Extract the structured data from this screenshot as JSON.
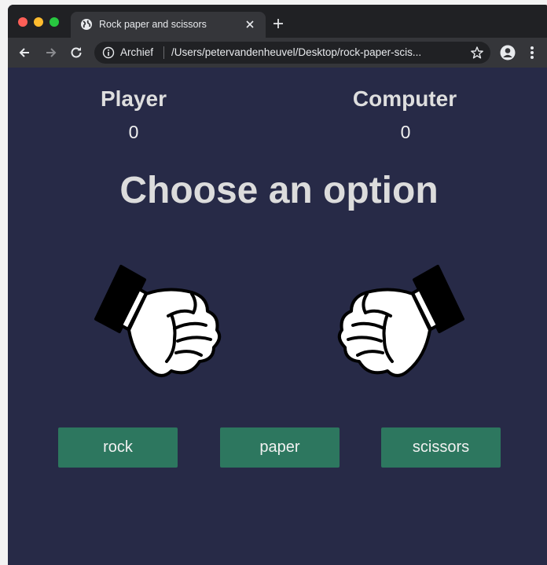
{
  "browser": {
    "tab": {
      "title": "Rock paper and scissors",
      "icon": "globe-icon"
    },
    "address_bar": {
      "site_label": "Archief",
      "url": "/Users/petervandenheuvel/Desktop/rock-paper-scis..."
    }
  },
  "game": {
    "player": {
      "label": "Player",
      "score": "0"
    },
    "computer": {
      "label": "Computer",
      "score": "0"
    },
    "headline": "Choose an option",
    "choices": [
      {
        "label": "rock"
      },
      {
        "label": "paper"
      },
      {
        "label": "scissors"
      }
    ],
    "player_hand": "rock-fist-icon",
    "computer_hand": "rock-fist-icon"
  },
  "colors": {
    "page_background": "#272a47",
    "button_background": "#2d775f",
    "text": "#dedede"
  }
}
